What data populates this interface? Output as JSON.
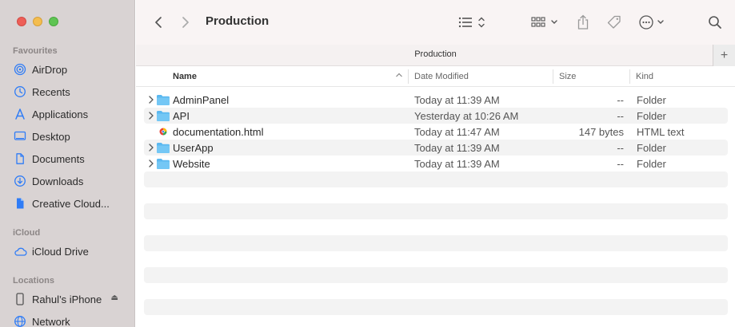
{
  "window": {
    "title": "Production",
    "path_title": "Production"
  },
  "sidebar": {
    "favourites_header": "Favourites",
    "favourites": [
      {
        "label": "AirDrop",
        "icon": "airdrop-icon"
      },
      {
        "label": "Recents",
        "icon": "clock-icon"
      },
      {
        "label": "Applications",
        "icon": "applications-icon"
      },
      {
        "label": "Desktop",
        "icon": "desktop-icon"
      },
      {
        "label": "Documents",
        "icon": "document-icon"
      },
      {
        "label": "Downloads",
        "icon": "download-icon"
      },
      {
        "label": "Creative Cloud...",
        "icon": "file-icon"
      }
    ],
    "icloud_header": "iCloud",
    "icloud": [
      {
        "label": "iCloud Drive",
        "icon": "cloud-icon"
      }
    ],
    "locations_header": "Locations",
    "locations": [
      {
        "label": "Rahul’s iPhone",
        "icon": "iphone-icon"
      },
      {
        "label": "Network",
        "icon": "network-icon"
      }
    ]
  },
  "columns": {
    "name": "Name",
    "date": "Date Modified",
    "size": "Size",
    "kind": "Kind"
  },
  "files": [
    {
      "name": "AdminPanel",
      "date": "Today at 11:39 AM",
      "size": "--",
      "kind": "Folder",
      "type": "folder"
    },
    {
      "name": "API",
      "date": "Yesterday at 10:26 AM",
      "size": "--",
      "kind": "Folder",
      "type": "folder"
    },
    {
      "name": "documentation.html",
      "date": "Today at 11:47 AM",
      "size": "147 bytes",
      "kind": "HTML text",
      "type": "html"
    },
    {
      "name": "UserApp",
      "date": "Today at 11:39 AM",
      "size": "--",
      "kind": "Folder",
      "type": "folder"
    },
    {
      "name": "Website",
      "date": "Today at 11:39 AM",
      "size": "--",
      "kind": "Folder",
      "type": "folder"
    }
  ],
  "colors": {
    "accent": "#2f7cf6",
    "folder": "#5bb8f0",
    "sidebar_bg": "#d9d3d3"
  }
}
